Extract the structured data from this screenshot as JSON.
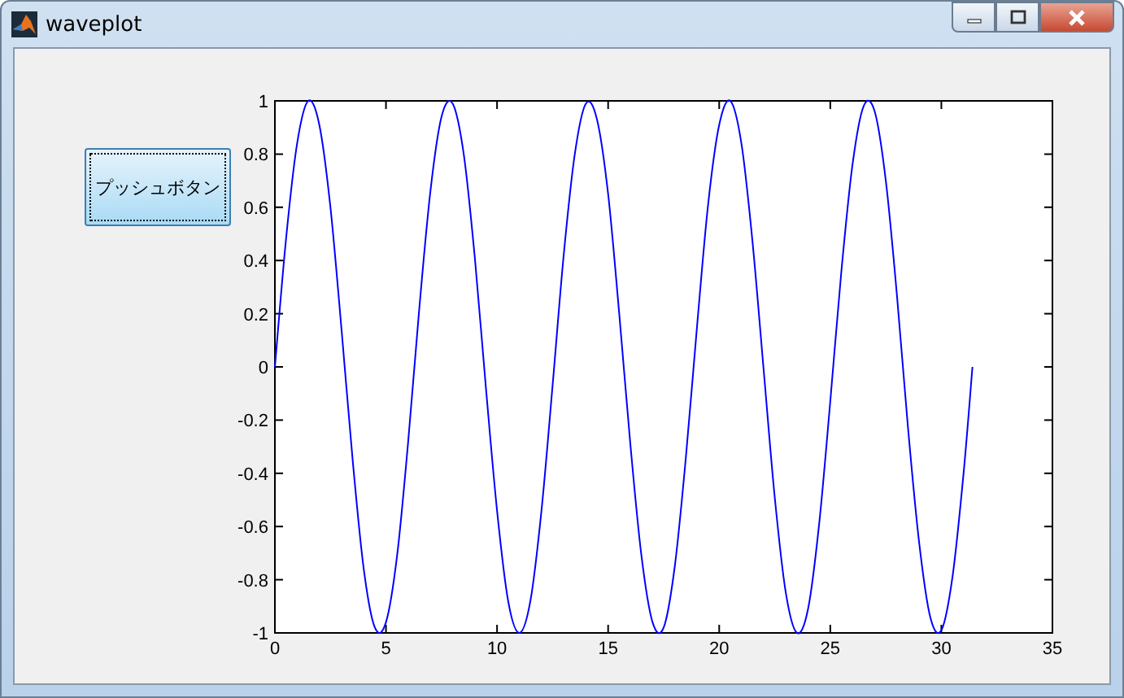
{
  "window": {
    "title": "waveplot"
  },
  "push_button": {
    "label": "プッシュボタン"
  },
  "plot": {
    "chart_data": {
      "type": "line",
      "xlim": [
        0,
        35
      ],
      "ylim": [
        -1,
        1
      ],
      "xticks": [
        0,
        5,
        10,
        15,
        20,
        25,
        30,
        35
      ],
      "yticks": [
        -1,
        -0.8,
        -0.6,
        -0.4,
        -0.2,
        0,
        0.2,
        0.4,
        0.6,
        0.8,
        1
      ],
      "x": [
        0,
        0.5,
        1,
        1.5,
        2,
        2.5,
        3,
        3.5,
        4,
        4.5,
        5,
        5.5,
        6,
        6.5,
        7,
        7.5,
        8,
        8.5,
        9,
        9.5,
        10,
        10.5,
        11,
        11.5,
        12,
        12.5,
        13,
        13.5,
        14,
        14.5,
        15,
        15.5,
        16,
        16.5,
        17,
        17.5,
        18,
        18.5,
        19,
        19.5,
        20,
        20.5,
        21,
        21.5,
        22,
        22.5,
        23,
        23.5,
        24,
        24.5,
        25,
        25.5,
        26,
        26.5,
        27,
        27.5,
        28,
        28.5,
        29,
        29.5,
        30,
        30.5,
        31,
        31.4
      ],
      "series": [
        {
          "color": "#0000ff",
          "values": [
            0,
            0.48,
            0.84,
            1.0,
            0.91,
            0.6,
            0.14,
            -0.35,
            -0.76,
            -0.98,
            -0.96,
            -0.71,
            -0.28,
            0.22,
            0.66,
            0.94,
            0.99,
            0.8,
            0.41,
            -0.08,
            -0.54,
            -0.88,
            -1.0,
            -0.88,
            -0.54,
            -0.07,
            0.42,
            0.8,
            0.99,
            0.93,
            0.65,
            0.2,
            -0.29,
            -0.71,
            -0.96,
            -0.98,
            -0.75,
            -0.34,
            0.15,
            0.61,
            0.91,
            1.0,
            0.84,
            0.47,
            -0.01,
            -0.49,
            -0.85,
            -1.0,
            -0.91,
            -0.59,
            -0.13,
            0.36,
            0.76,
            0.98,
            0.96,
            0.7,
            0.27,
            -0.23,
            -0.66,
            -0.94,
            -0.99,
            -0.79,
            -0.4,
            0.0
          ]
        }
      ]
    }
  }
}
